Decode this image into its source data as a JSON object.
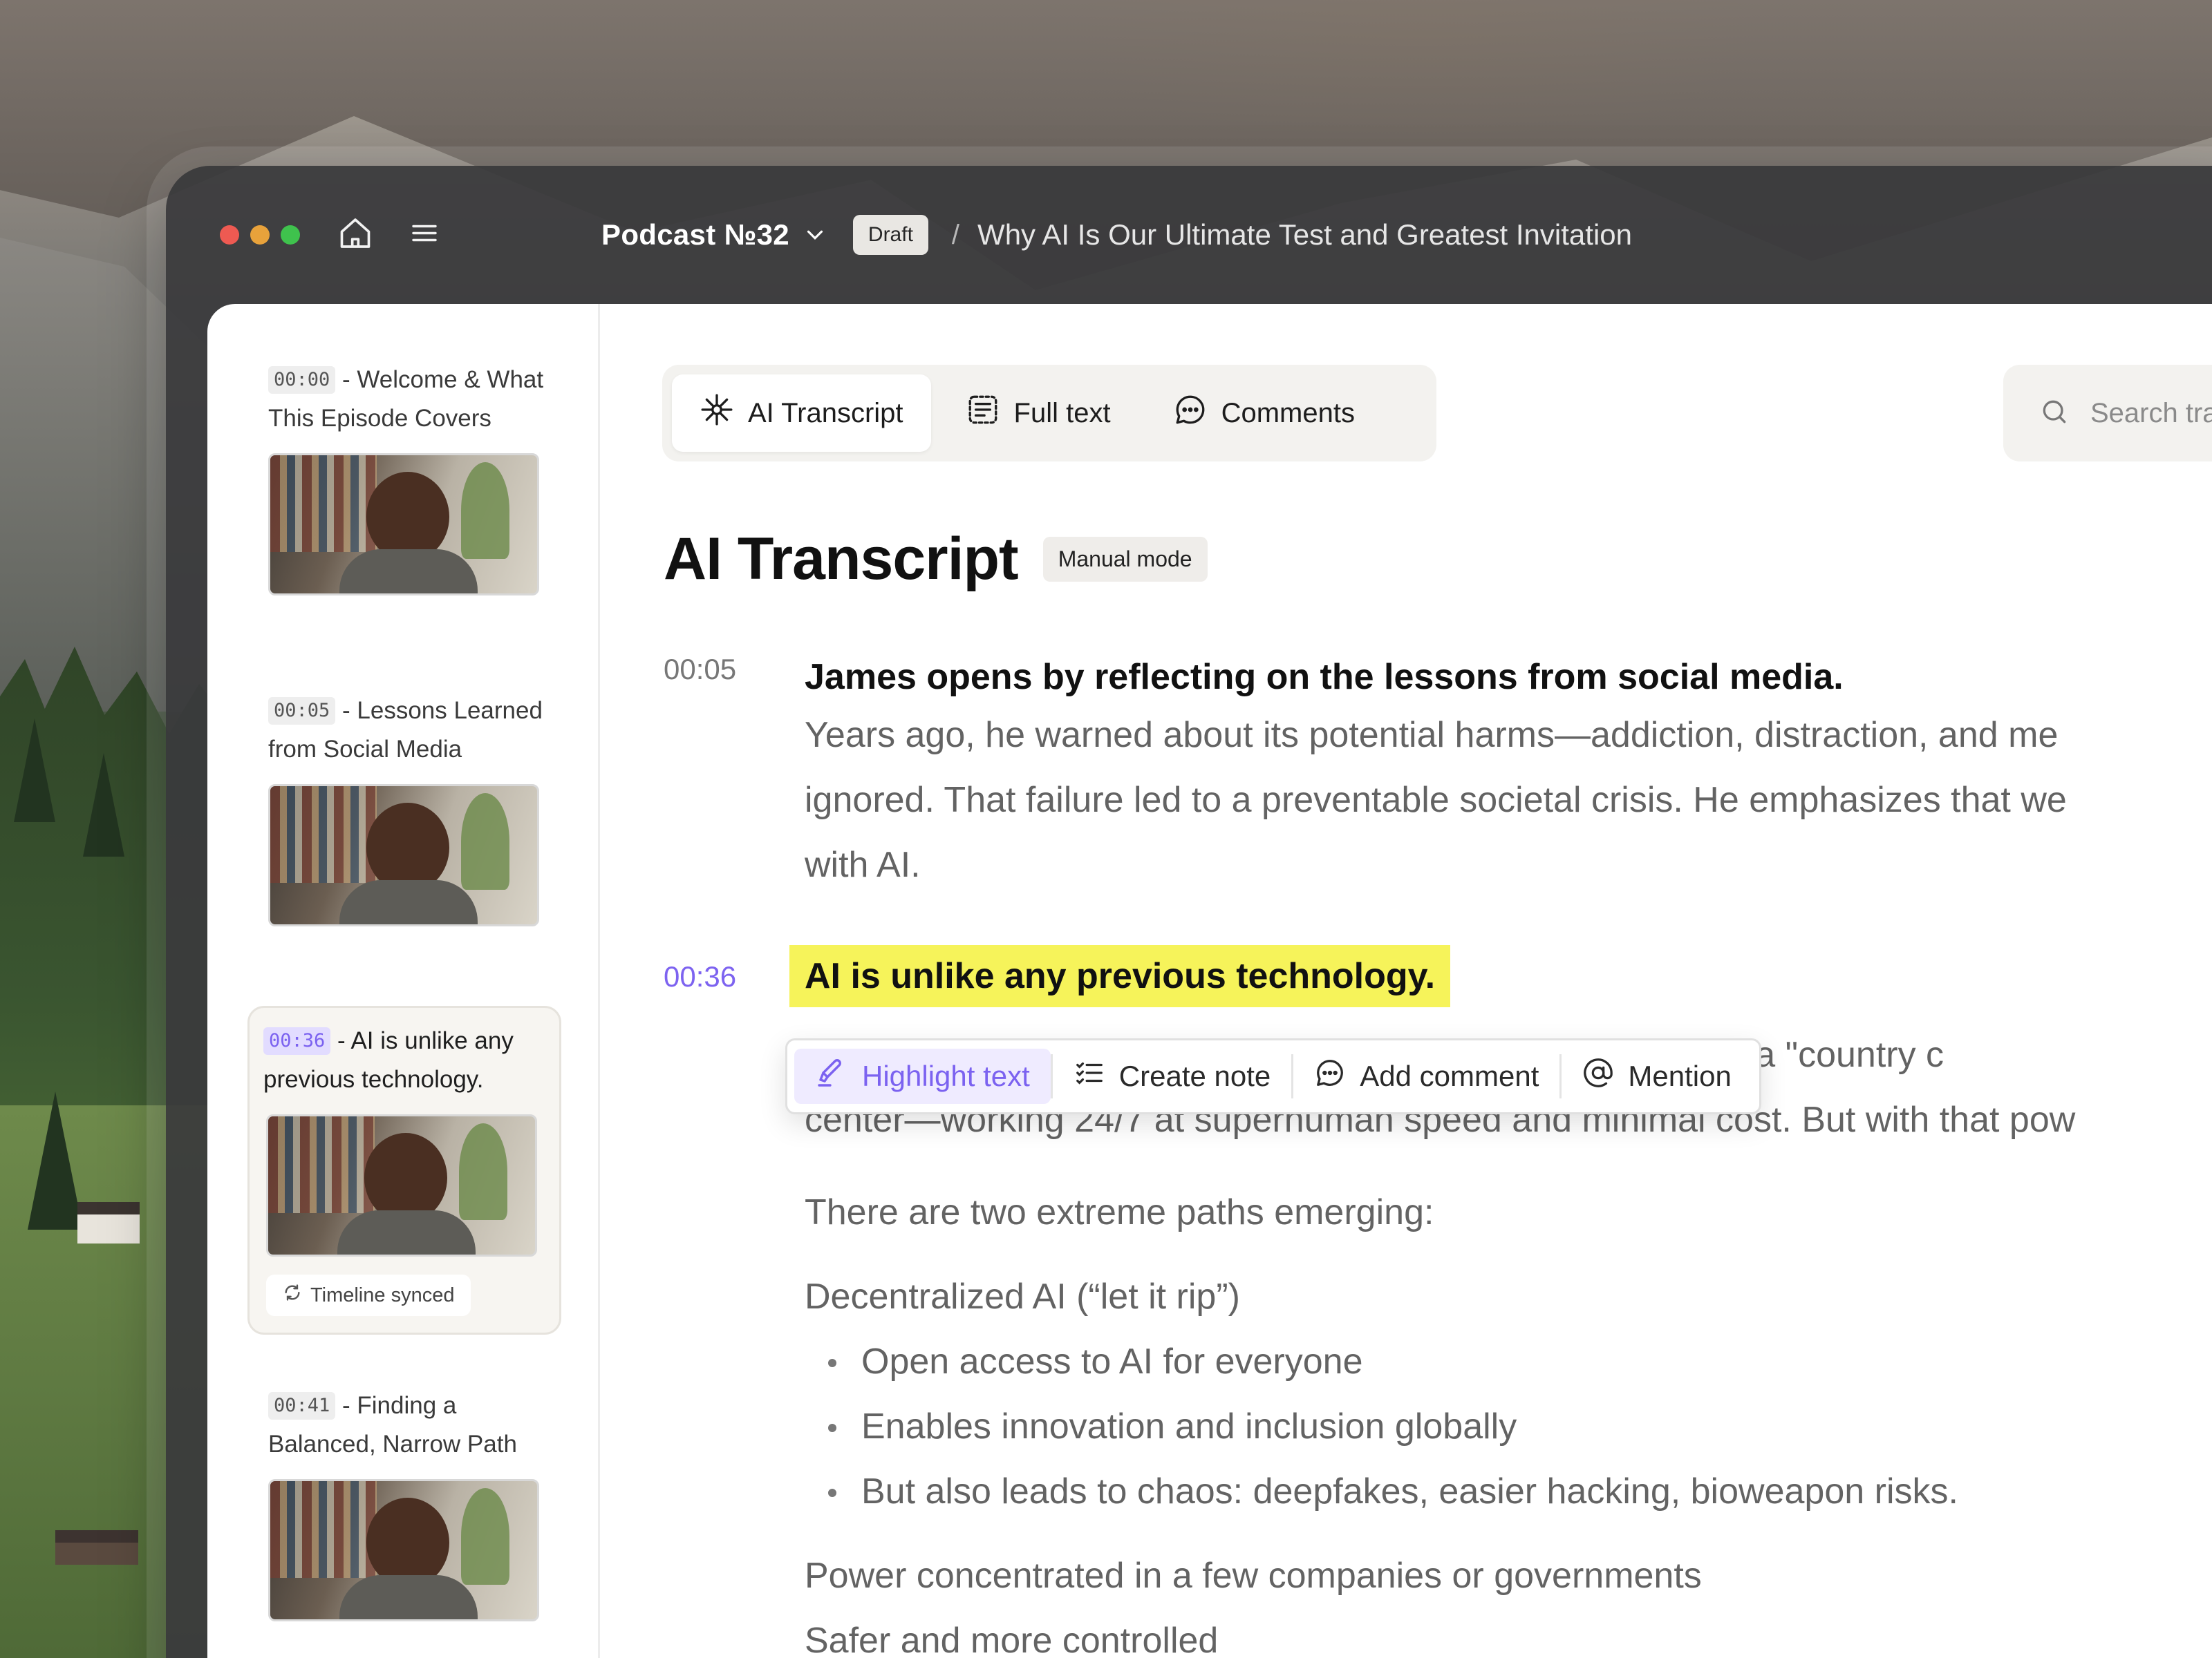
{
  "window": {
    "podcast_title": "Podcast №32",
    "status_badge": "Draft",
    "breadcrumb_separator": "/",
    "episode_title": "Why AI Is Our Ultimate Test and Greatest Invitation"
  },
  "sidebar": {
    "chapters": [
      {
        "time": "00:00",
        "title": "- Welcome & What This Episode Covers"
      },
      {
        "time": "00:05",
        "title": "- Lessons Learned from Social Media"
      },
      {
        "time": "00:36",
        "title": "- AI is unlike any previous technology.",
        "active": true,
        "sync_label": "Timeline synced"
      },
      {
        "time": "00:41",
        "title": "- Finding a Balanced, Narrow Path"
      }
    ]
  },
  "tabs": [
    {
      "label": "AI Transcript",
      "icon": "sparkle-icon",
      "selected": true
    },
    {
      "label": "Full text",
      "icon": "text-lines-icon",
      "selected": false
    },
    {
      "label": "Comments",
      "icon": "chat-bubble-icon",
      "selected": false
    }
  ],
  "search": {
    "placeholder": "Search transcript by"
  },
  "page": {
    "title": "AI Transcript",
    "mode_badge": "Manual mode"
  },
  "transcript": {
    "entries": [
      {
        "time": "00:05",
        "heading": "James opens by reflecting on the lessons from social media.",
        "lines": [
          "Years ago, he warned about its potential harms—addiction, distraction, and me",
          "ignored. That failure led to a preventable societal crisis. He emphasizes that we",
          "with AI."
        ]
      },
      {
        "time": "00:36",
        "heading": "AI is unlike any previous technology.",
        "partial_line_right": "pared to a \"country c",
        "partial_line_2": "center—working 24/7 at superhuman speed and minimal cost. But with that pow",
        "intro": "There are two extreme paths emerging:",
        "path_1_title": "Decentralized AI (“let it rip”)",
        "path_1_bullets": [
          "Open access to AI for everyone",
          "Enables innovation and inclusion globally",
          "But also leads to chaos: deepfakes, easier hacking, bioweapon risks."
        ],
        "path_2_lines": [
          "Power concentrated in a few companies or governments",
          "Safer and more controlled"
        ]
      }
    ]
  },
  "selection_toolbar": {
    "items": [
      {
        "label": "Highlight text",
        "icon": "highlighter-icon",
        "active": true
      },
      {
        "label": "Create note",
        "icon": "checklist-icon"
      },
      {
        "label": "Add comment",
        "icon": "comment-icon"
      },
      {
        "label": "Mention",
        "icon": "at-sign-icon"
      }
    ]
  },
  "colors": {
    "accent": "#7b62f0",
    "highlight": "#f6f35a",
    "traffic_red": "#ee5a52",
    "traffic_yellow": "#e8a23b",
    "traffic_green": "#3fc24d"
  }
}
